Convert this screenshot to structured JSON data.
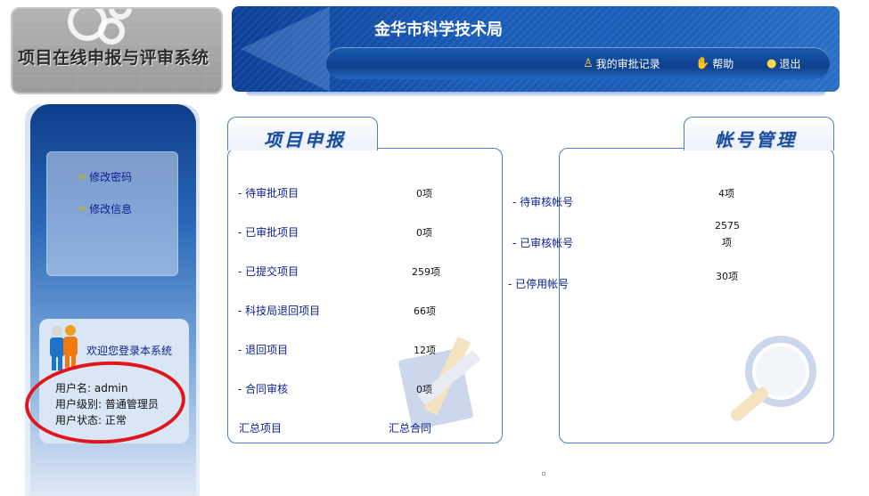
{
  "logo": {
    "title": "项目在线申报与评审系统"
  },
  "header": {
    "org_title": "金华市科学技术局",
    "nav": [
      {
        "label": "我的审批记录",
        "icon": "person-icon"
      },
      {
        "label": "帮助",
        "icon": "hand-icon"
      },
      {
        "label": "退出",
        "icon": "lightbulb-icon"
      }
    ]
  },
  "sidebar": {
    "menu": [
      {
        "label": "修改密码",
        "icon": "pencil-icon"
      },
      {
        "label": "修改信息",
        "icon": "pencil-icon"
      }
    ],
    "welcome": "欢迎您登录本系统",
    "user": {
      "name_line": "用户名: admin",
      "level_line": "用户级别: 普通管理员",
      "status_line": "用户状态: 正常"
    }
  },
  "project_panel": {
    "title": "项目申报",
    "rows": [
      {
        "label": "- 待审批项目",
        "value": "0项"
      },
      {
        "label": "- 已审批项目",
        "value": "0项"
      },
      {
        "label": "- 已提交项目",
        "value": "259项"
      },
      {
        "label": "- 科技局退回项目",
        "value": "66项"
      },
      {
        "label": "- 退回项目",
        "value": "12项"
      },
      {
        "label": "- 合同审核",
        "value": "0项"
      }
    ],
    "footer_left": "汇总项目",
    "footer_right": "汇总合同"
  },
  "account_panel": {
    "title": "帐号管理",
    "rows": [
      {
        "label": "- 待审核帐号",
        "value": "4项"
      },
      {
        "label": "- 已审核帐号",
        "value": "2575",
        "value2": "项"
      },
      {
        "label": "- 已停用帐号",
        "value": "30项"
      }
    ]
  }
}
